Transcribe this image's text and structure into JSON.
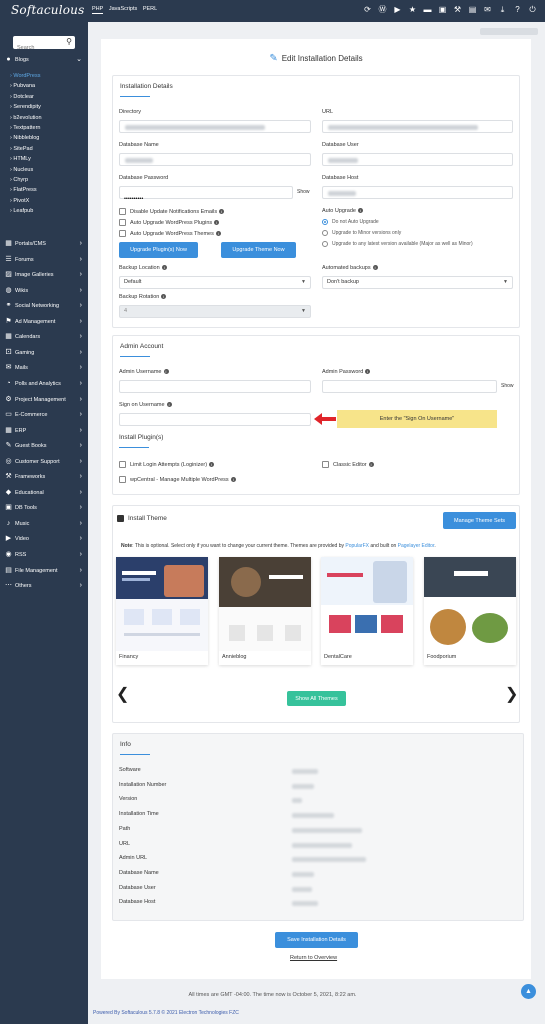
{
  "topbar": {
    "logo": "Softaculous",
    "tabs": [
      "PHP",
      "JavaScripts",
      "PERL"
    ],
    "icons": [
      "cpanel-icon",
      "wordpress-icon",
      "play-icon",
      "star-icon",
      "box-icon",
      "window-icon",
      "wrench-icon",
      "file-icon",
      "mail-icon",
      "download-icon",
      "help-icon",
      "power-icon"
    ]
  },
  "sidebar": {
    "search_placeholder": "Search",
    "blogs_label": "Blogs",
    "blogs": [
      "WordPress",
      "Pubvana",
      "Dotclear",
      "Serendipity",
      "b2evolution",
      "Textpattern",
      "Nibbleblog",
      "SitePad",
      "HTMLy",
      "Nucleus",
      "Chyrp",
      "FlatPress",
      "PivotX",
      "Leafpub"
    ],
    "categories": [
      "Portals/CMS",
      "Forums",
      "Image Galleries",
      "Wikis",
      "Social Networking",
      "Ad Management",
      "Calendars",
      "Gaming",
      "Mails",
      "Polls and Analytics",
      "Project Management",
      "E-Commerce",
      "ERP",
      "Guest Books",
      "Customer Support",
      "Frameworks",
      "Educational",
      "DB Tools",
      "Music",
      "Video",
      "RSS",
      "File Management",
      "Others"
    ]
  },
  "page": {
    "title": "Edit Installation Details"
  },
  "installation": {
    "title": "Installation Details",
    "directory_label": "Directory",
    "url_label": "URL",
    "dbname_label": "Database Name",
    "dbuser_label": "Database User",
    "dbpass_label": "Database Password",
    "dbpass_value": "••••••••••",
    "dbhost_label": "Database Host",
    "show_label": "Show",
    "checks": [
      "Disable Update Notifications Emails",
      "Auto Upgrade WordPress Plugins",
      "Auto Upgrade WordPress Themes"
    ],
    "auto_upgrade_label": "Auto Upgrade",
    "radios": [
      "Do not Auto Upgrade",
      "Upgrade to Minor versions only",
      "Upgrade to any latest version available (Major as well as Minor)"
    ],
    "upgrade_plugins_btn": "Upgrade Plugin(s) Now",
    "upgrade_theme_btn": "Upgrade Theme Now",
    "backup_location_label": "Backup Location",
    "backup_location_value": "Default",
    "automated_backups_label": "Automated backups",
    "automated_backups_value": "Don't backup",
    "backup_rotation_label": "Backup Rotation",
    "backup_rotation_value": "4"
  },
  "admin": {
    "title": "Admin Account",
    "username_label": "Admin Username",
    "password_label": "Admin Password",
    "show_label": "Show",
    "sign_on_label": "Sign on Username",
    "callout": "Enter the \"Sign On Username\"",
    "plugins_title": "Install Plugin(s)",
    "plugin1": "Limit Login Attempts (Loginizer)",
    "plugin2": "Classic Editor",
    "plugin3": "wpCentral - Manage Multiple WordPress"
  },
  "theme": {
    "title": "Install Theme",
    "manage_btn": "Manage Theme Sets",
    "note_bold": "Note",
    "note_text": ": This is optional. Select only if you want to change your current theme. Themes are provided by ",
    "note_link1": "PopularFX",
    "note_mid": " and built on ",
    "note_link2": "Pagelayer Editor",
    "note_end": ".",
    "themes": [
      "Financy",
      "Annieblog",
      "DentalCare",
      "Foodporium"
    ],
    "show_all_btn": "Show All Themes"
  },
  "info": {
    "title": "Info",
    "rows": [
      "Software",
      "Installation Number",
      "Version",
      "Installation Time",
      "Path",
      "URL",
      "Admin URL",
      "Database Name",
      "Database User",
      "Database Host"
    ]
  },
  "actions": {
    "save_btn": "Save Installation Details",
    "return_link": "Return to Overview"
  },
  "footer": {
    "times": "All times are GMT -04:00. The time now is October 5, 2021, 8:22 am.",
    "powered_prefix": "Powered By Softaculous 5.7.8 © 2021 ",
    "powered_link": "Electron Technologies FZC"
  },
  "colors": {
    "sidebar_bg": "#2b3a4f",
    "accent": "#3b8fdc",
    "green": "#36c29b",
    "callout": "#f7e48a",
    "arrow": "#e0242a"
  }
}
